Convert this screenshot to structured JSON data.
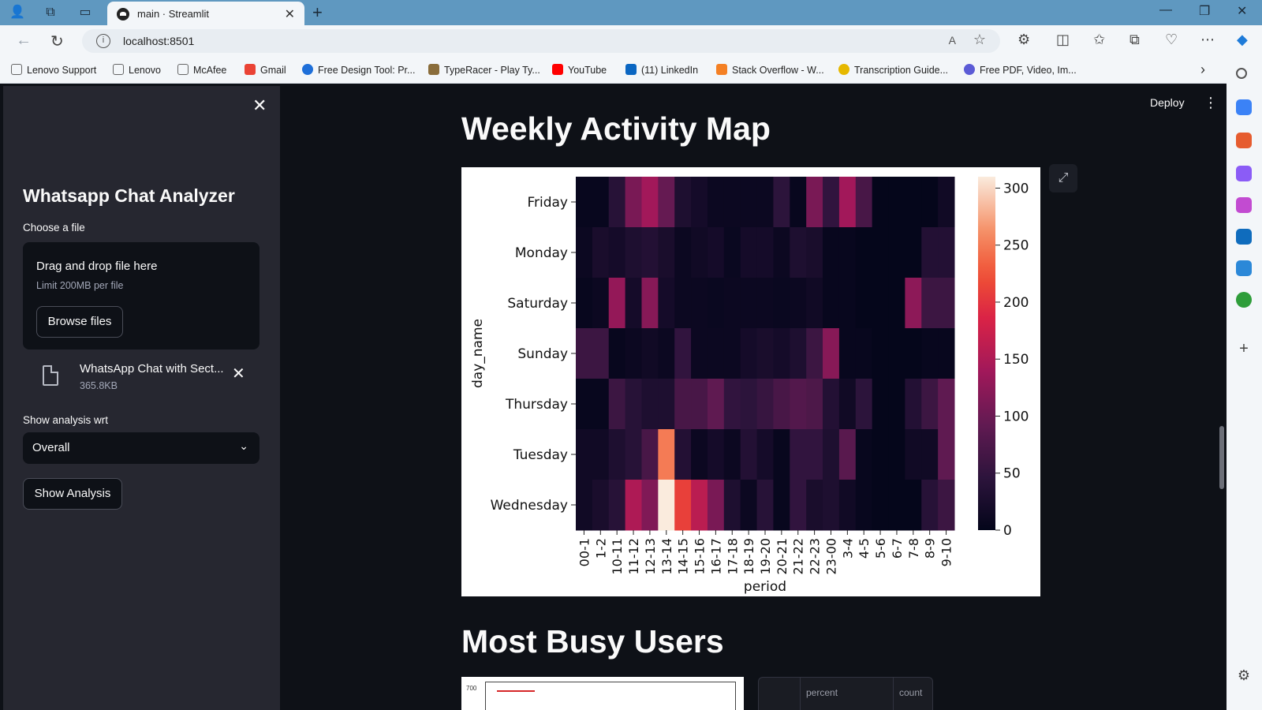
{
  "browser": {
    "tab_title": "main · Streamlit",
    "url": "localhost:8501",
    "reader_label": "A",
    "bookmarks": [
      {
        "label": "Lenovo Support",
        "color": "#666666"
      },
      {
        "label": "Lenovo",
        "color": "#666666"
      },
      {
        "label": "McAfee",
        "color": "#666666"
      },
      {
        "label": "Gmail",
        "color": "#ea4335"
      },
      {
        "label": "Free Design Tool: Pr...",
        "color": "#1e6fd9"
      },
      {
        "label": "TypeRacer - Play Ty...",
        "color": "#8a6d3b"
      },
      {
        "label": "YouTube",
        "color": "#ff0000"
      },
      {
        "label": "(11) LinkedIn",
        "color": "#0a66c2"
      },
      {
        "label": "Stack Overflow - W...",
        "color": "#f48024"
      },
      {
        "label": "Transcription Guide...",
        "color": "#e6b800"
      },
      {
        "label": "Free PDF, Video, Im...",
        "color": "#5b5bd6"
      }
    ]
  },
  "sidebar": {
    "title": "Whatsapp Chat Analyzer",
    "choose_file_label": "Choose a file",
    "dropzone_title": "Drag and drop file here",
    "dropzone_limit": "Limit 200MB per file",
    "browse_button": "Browse files",
    "file_name": "WhatsApp Chat with Sect...",
    "file_size": "365.8KB",
    "analysis_label": "Show analysis wrt",
    "analysis_value": "Overall",
    "show_button": "Show Analysis"
  },
  "header": {
    "deploy_label": "Deploy"
  },
  "main": {
    "heading_activity": "Weekly Activity Map",
    "heading_users": "Most Busy Users",
    "bottom_chart_tick": "700",
    "table_headers": [
      "percent",
      "count"
    ]
  },
  "chart_data": {
    "type": "heatmap",
    "title": "",
    "xlabel": "period",
    "ylabel": "day_name",
    "x": [
      "00-1",
      "1-2",
      "10-11",
      "11-12",
      "12-13",
      "13-14",
      "14-15",
      "15-16",
      "16-17",
      "17-18",
      "18-19",
      "19-20",
      "20-21",
      "21-22",
      "22-23",
      "23-00",
      "3-4",
      "4-5",
      "5-6",
      "6-7",
      "7-8",
      "8-9",
      "9-10"
    ],
    "y": [
      "Friday",
      "Monday",
      "Saturday",
      "Sunday",
      "Thursday",
      "Tuesday",
      "Wednesday"
    ],
    "colorbar_ticks": [
      0,
      50,
      100,
      150,
      200,
      250,
      300
    ],
    "vmin": 0,
    "vmax": 310,
    "values": [
      [
        5,
        5,
        40,
        110,
        140,
        95,
        30,
        20,
        10,
        10,
        10,
        10,
        45,
        5,
        110,
        50,
        140,
        70,
        2,
        2,
        2,
        2,
        15,
        15
      ],
      [
        10,
        25,
        20,
        30,
        35,
        25,
        10,
        15,
        20,
        8,
        20,
        20,
        10,
        30,
        25,
        5,
        5,
        2,
        2,
        2,
        2,
        35,
        35
      ],
      [
        5,
        10,
        130,
        20,
        120,
        20,
        10,
        10,
        8,
        10,
        10,
        10,
        8,
        10,
        15,
        5,
        5,
        2,
        2,
        2,
        125,
        60,
        60
      ],
      [
        60,
        60,
        5,
        10,
        15,
        10,
        50,
        10,
        10,
        10,
        20,
        25,
        20,
        30,
        60,
        120,
        5,
        5,
        2,
        2,
        2,
        5,
        5
      ],
      [
        5,
        5,
        60,
        40,
        30,
        30,
        70,
        70,
        90,
        50,
        45,
        55,
        70,
        80,
        75,
        35,
        15,
        45,
        2,
        2,
        35,
        60,
        90
      ],
      [
        15,
        15,
        30,
        40,
        70,
        250,
        35,
        10,
        20,
        10,
        35,
        20,
        5,
        50,
        50,
        30,
        85,
        5,
        2,
        2,
        15,
        15,
        90
      ],
      [
        15,
        25,
        40,
        150,
        115,
        310,
        210,
        160,
        110,
        30,
        10,
        40,
        5,
        50,
        25,
        30,
        15,
        5,
        2,
        2,
        2,
        40,
        60
      ]
    ]
  }
}
